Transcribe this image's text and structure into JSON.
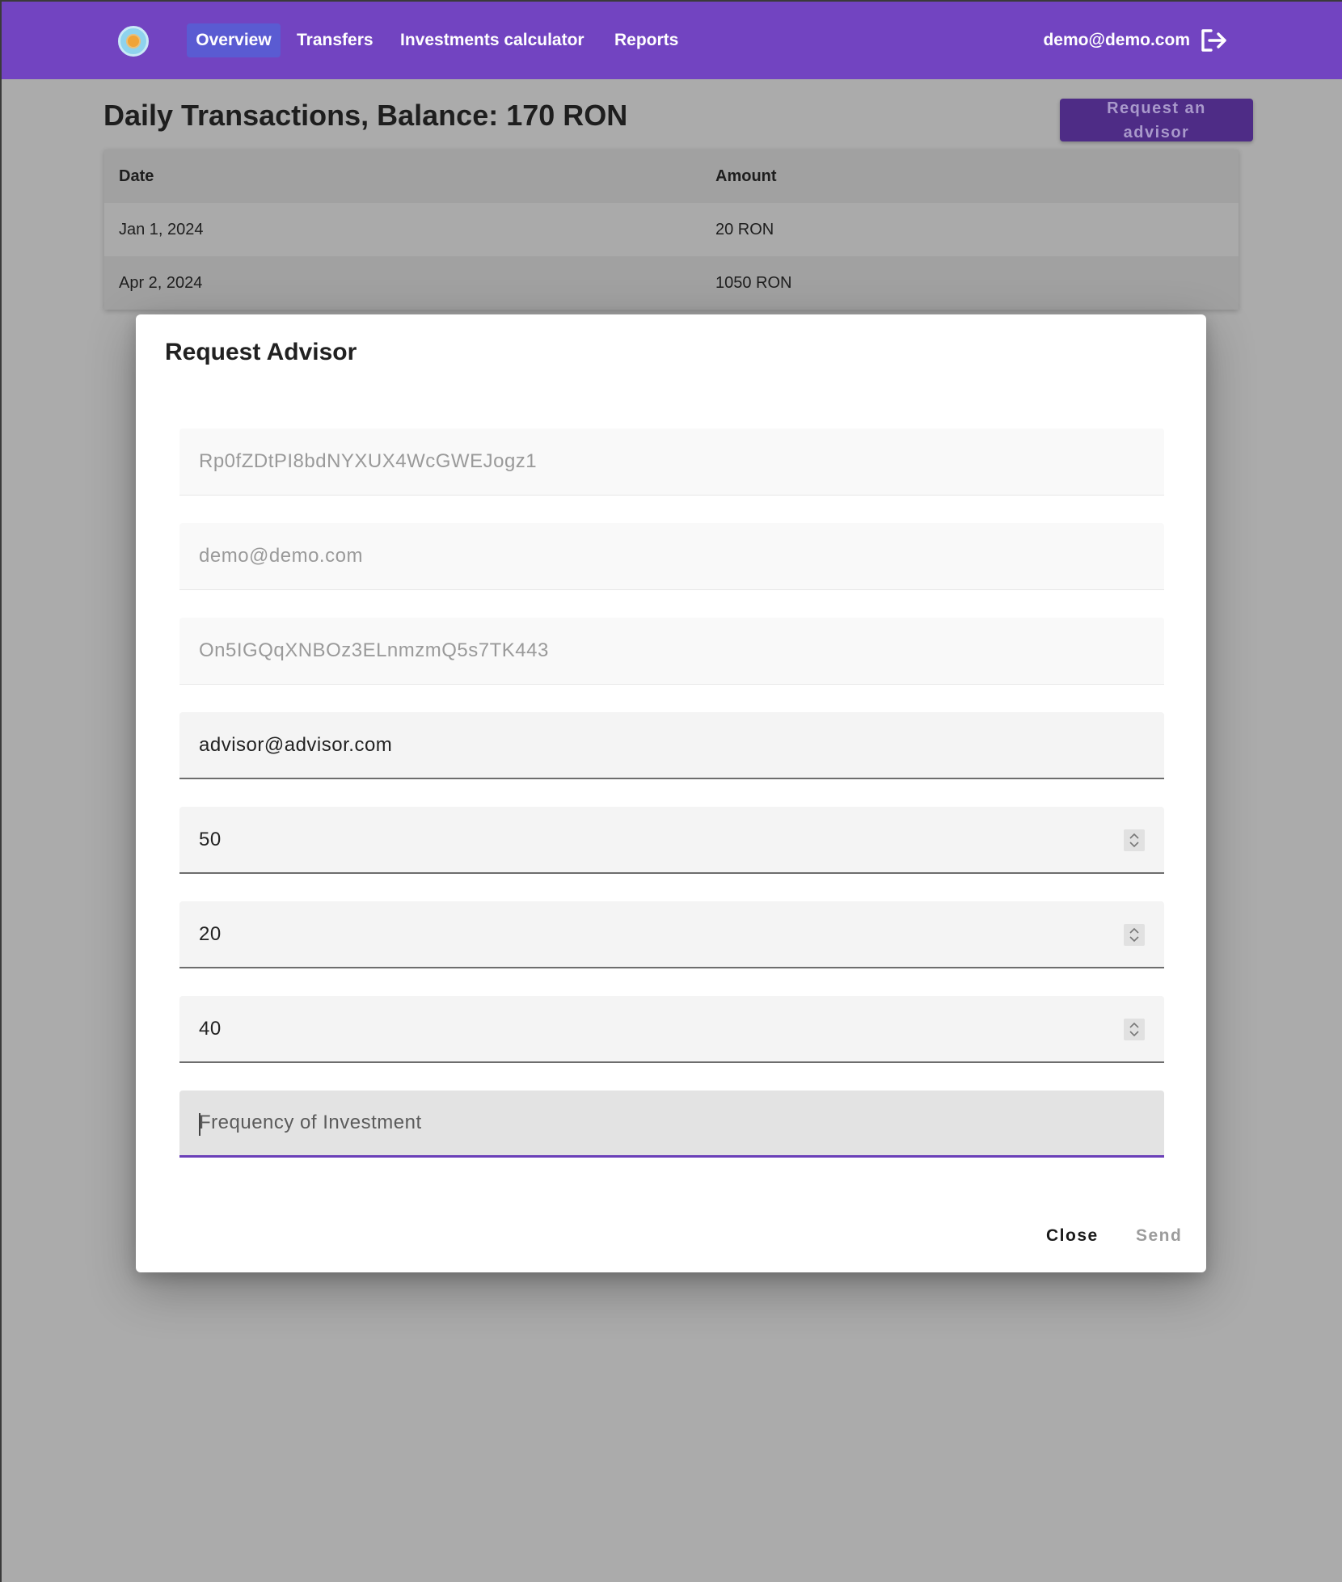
{
  "nav": {
    "items": [
      {
        "label": "Overview",
        "active": true
      },
      {
        "label": "Transfers"
      },
      {
        "label": "Investments calculator"
      },
      {
        "label": "Reports"
      }
    ],
    "user_email": "demo@demo.com",
    "logout_icon": "logout-icon",
    "logo_icon": "app-logo-icon"
  },
  "page": {
    "title": "Daily Transactions, Balance: 170 RON",
    "request_button_label": "Request an advisor",
    "table": {
      "headers": [
        "Date",
        "Amount"
      ],
      "rows": [
        {
          "date": "Jan 1, 2024",
          "amount": "20 RON"
        },
        {
          "date": "Apr 2, 2024",
          "amount": "1050 RON"
        }
      ]
    }
  },
  "modal": {
    "title": "Request Advisor",
    "fields": [
      {
        "value": "Rp0fZDtPI8bdNYXUX4WcGWEJogz1",
        "state": "disabled"
      },
      {
        "value": "demo@demo.com",
        "state": "disabled"
      },
      {
        "value": "On5IGQqXNBOz3ELnmzmQ5s7TK443",
        "state": "disabled"
      },
      {
        "value": "advisor@advisor.com",
        "state": "active"
      },
      {
        "value": "50",
        "state": "active",
        "type": "number"
      },
      {
        "value": "20",
        "state": "active",
        "type": "number"
      },
      {
        "value": "40",
        "state": "active",
        "type": "number"
      },
      {
        "value": "",
        "placeholder": "Frequency of Investment",
        "state": "focused"
      }
    ],
    "close_label": "Close",
    "send_label": "Send"
  },
  "colors": {
    "topbar": "#7244c1",
    "nav_active": "#5a5bd2",
    "accent": "#6a3fb8",
    "overlay": "#ababab"
  }
}
